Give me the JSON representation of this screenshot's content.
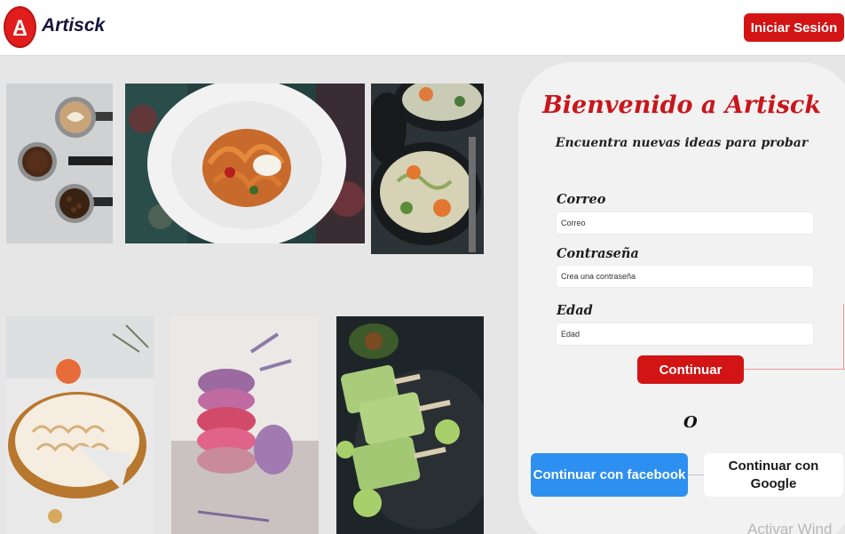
{
  "header": {
    "logo_letter": "A",
    "brand": "Artisck",
    "login_label": "Iniciar Sesión"
  },
  "gallery": [
    {
      "name": "coffee-photo",
      "description_icon": "coffee-icon"
    },
    {
      "name": "pasta-photo",
      "description_icon": "pasta-icon"
    },
    {
      "name": "soup-photo",
      "description_icon": "soup-icon"
    },
    {
      "name": "meringue-pie-photo",
      "description_icon": "pie-icon"
    },
    {
      "name": "macarons-photo",
      "description_icon": "macaron-icon"
    },
    {
      "name": "avocado-popsicles-photo",
      "description_icon": "popsicle-icon"
    }
  ],
  "signup": {
    "title": "Bienvenido a Artisck",
    "subtitle": "Encuentra nuevas ideas para probar",
    "email_label": "Correo",
    "email_placeholder": "Correo",
    "password_label": "Contraseña",
    "password_placeholder": "Crea una contraseña",
    "age_label": "Edad",
    "age_placeholder": "Edad",
    "continue_label": "Continuar",
    "or_text": "O",
    "facebook_label": "Continuar con facebook",
    "google_label": "Continuar con Google"
  },
  "watermark": "Activar Wind",
  "colors": {
    "accent_red": "#d21414",
    "facebook_blue": "#2d8ff0",
    "brand_navy": "#16143a"
  }
}
